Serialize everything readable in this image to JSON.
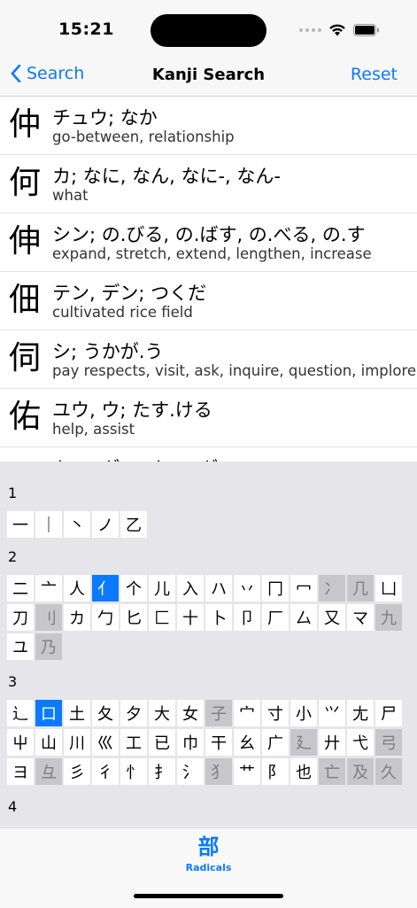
{
  "status": {
    "time": "15:21"
  },
  "nav": {
    "back_label": "Search",
    "title": "Kanji Search",
    "reset_label": "Reset"
  },
  "results": [
    {
      "kanji": "仲",
      "reading": "チュウ; なか",
      "meaning": "go-between, relationship"
    },
    {
      "kanji": "何",
      "reading": "カ; なに, なん, なに-, なん-",
      "meaning": "what"
    },
    {
      "kanji": "伸",
      "reading": "シン; の.びる, の.ばす, の.べる, の.す",
      "meaning": "expand, stretch, extend, lengthen, increase"
    },
    {
      "kanji": "佃",
      "reading": "テン, デン; つくだ",
      "meaning": "cultivated rice field"
    },
    {
      "kanji": "伺",
      "reading": "シ; うかが.う",
      "meaning": "pay respects, visit, ask, inquire, question, implore"
    },
    {
      "kanji": "佑",
      "reading": "ユウ, ウ; たす.ける",
      "meaning": "help, assist"
    },
    {
      "kanji": "",
      "reading": "キャ, ギャ; キャ, ギャ",
      "meaning": ""
    }
  ],
  "radicals": [
    {
      "strokes": "1",
      "items": [
        {
          "c": "一",
          "s": "n"
        },
        {
          "c": "｜",
          "s": "n"
        },
        {
          "c": "丶",
          "s": "n"
        },
        {
          "c": "ノ",
          "s": "n"
        },
        {
          "c": "乙",
          "s": "n"
        }
      ]
    },
    {
      "strokes": "2",
      "items": [
        {
          "c": "二",
          "s": "n"
        },
        {
          "c": "亠",
          "s": "n"
        },
        {
          "c": "人",
          "s": "n"
        },
        {
          "c": "亻",
          "s": "sel"
        },
        {
          "c": "个",
          "s": "n"
        },
        {
          "c": "儿",
          "s": "n"
        },
        {
          "c": "入",
          "s": "n"
        },
        {
          "c": "ハ",
          "s": "n"
        },
        {
          "c": "丷",
          "s": "n"
        },
        {
          "c": "冂",
          "s": "n"
        },
        {
          "c": "冖",
          "s": "n"
        },
        {
          "c": "冫",
          "s": "dis"
        },
        {
          "c": "几",
          "s": "dis"
        },
        {
          "c": "凵",
          "s": "n"
        },
        {
          "c": "刀",
          "s": "n"
        },
        {
          "c": "刂",
          "s": "dis"
        },
        {
          "c": "カ",
          "s": "n"
        },
        {
          "c": "勹",
          "s": "n"
        },
        {
          "c": "匕",
          "s": "n"
        },
        {
          "c": "匚",
          "s": "n"
        },
        {
          "c": "十",
          "s": "n"
        },
        {
          "c": "卜",
          "s": "n"
        },
        {
          "c": "卩",
          "s": "n"
        },
        {
          "c": "厂",
          "s": "n"
        },
        {
          "c": "厶",
          "s": "n"
        },
        {
          "c": "又",
          "s": "n"
        },
        {
          "c": "マ",
          "s": "n"
        },
        {
          "c": "九",
          "s": "dis"
        },
        {
          "c": "ユ",
          "s": "n"
        },
        {
          "c": "乃",
          "s": "dis"
        }
      ]
    },
    {
      "strokes": "3",
      "items": [
        {
          "c": "⻌",
          "s": "n"
        },
        {
          "c": "口",
          "s": "sel"
        },
        {
          "c": "土",
          "s": "n"
        },
        {
          "c": "夂",
          "s": "n"
        },
        {
          "c": "夕",
          "s": "n"
        },
        {
          "c": "大",
          "s": "n"
        },
        {
          "c": "女",
          "s": "n"
        },
        {
          "c": "子",
          "s": "dis"
        },
        {
          "c": "宀",
          "s": "n"
        },
        {
          "c": "寸",
          "s": "n"
        },
        {
          "c": "小",
          "s": "n"
        },
        {
          "c": "⺍",
          "s": "n"
        },
        {
          "c": "尢",
          "s": "n"
        },
        {
          "c": "尸",
          "s": "n"
        },
        {
          "c": "屮",
          "s": "n"
        },
        {
          "c": "山",
          "s": "n"
        },
        {
          "c": "川",
          "s": "n"
        },
        {
          "c": "巛",
          "s": "n"
        },
        {
          "c": "工",
          "s": "n"
        },
        {
          "c": "已",
          "s": "n"
        },
        {
          "c": "巾",
          "s": "n"
        },
        {
          "c": "干",
          "s": "n"
        },
        {
          "c": "幺",
          "s": "n"
        },
        {
          "c": "广",
          "s": "n"
        },
        {
          "c": "廴",
          "s": "dis"
        },
        {
          "c": "廾",
          "s": "n"
        },
        {
          "c": "弋",
          "s": "n"
        },
        {
          "c": "弓",
          "s": "dis"
        },
        {
          "c": "ヨ",
          "s": "n"
        },
        {
          "c": "彑",
          "s": "dis"
        },
        {
          "c": "彡",
          "s": "n"
        },
        {
          "c": "彳",
          "s": "n"
        },
        {
          "c": "忄",
          "s": "n"
        },
        {
          "c": "扌",
          "s": "n"
        },
        {
          "c": "氵",
          "s": "n"
        },
        {
          "c": "犭",
          "s": "dis"
        },
        {
          "c": "艹",
          "s": "n"
        },
        {
          "c": "阝",
          "s": "n"
        },
        {
          "c": "也",
          "s": "n"
        },
        {
          "c": "亡",
          "s": "dis"
        },
        {
          "c": "及",
          "s": "dis"
        },
        {
          "c": "久",
          "s": "dis"
        }
      ]
    },
    {
      "strokes": "4",
      "items": []
    }
  ],
  "tabbar": {
    "icon_glyph": "部",
    "label": "Radicals"
  },
  "colors": {
    "accent": "#0a7aff",
    "disabled_cell": "#c6c6cb",
    "picker_bg": "#e5e5ea"
  }
}
